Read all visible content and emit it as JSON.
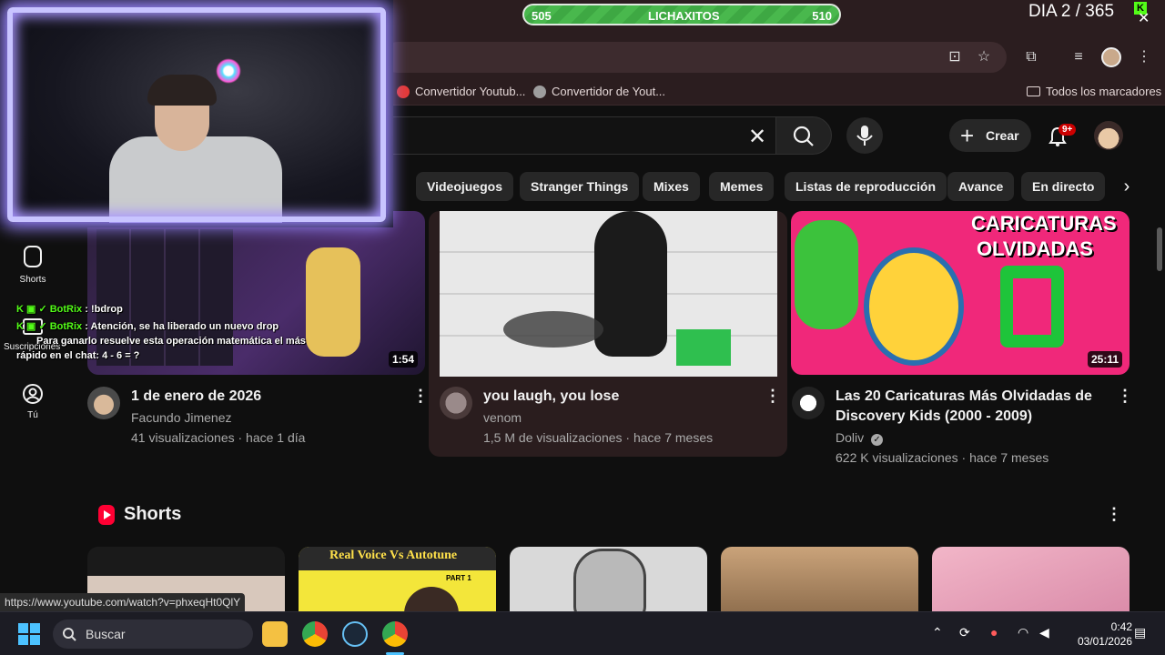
{
  "stream": {
    "progress_left": "505",
    "progress_label": "LICHAXITOS",
    "progress_right": "510",
    "day_counter": "DIA 2 / 365"
  },
  "bookmarks": {
    "items": [
      "Convertidor Youtub...",
      "Convertidor de Yout..."
    ],
    "all_label": "Todos los marcadores"
  },
  "youtube": {
    "create_label": "Crear",
    "notif_badge": "9+",
    "chips": [
      "Videojuegos",
      "Stranger Things",
      "Mixes",
      "Memes",
      "Listas de reproducción",
      "Avance",
      "En directo"
    ],
    "sidebar": {
      "shorts": "Shorts",
      "subs": "Suscripciones",
      "you": "Tú"
    },
    "videos": [
      {
        "title": "1 de enero de 2026",
        "channel": "Facundo Jimenez",
        "meta": "41 visualizaciones · hace 1 día",
        "duration": "1:54"
      },
      {
        "title": "you laugh, you lose",
        "channel": "venom",
        "meta": "1,5 M de visualizaciones · hace 7 meses",
        "duration": ""
      },
      {
        "title_line1": "Las 20 Caricaturas Más Olvidadas de",
        "title_line2": "Discovery Kids (2000 - 2009)",
        "channel": "Doliv",
        "meta": "622 K visualizaciones · hace 7 meses",
        "duration": "25:11",
        "thumb_line1": "CARICATURAS",
        "thumb_line2": "OLVIDADAS"
      }
    ],
    "shorts_title": "Shorts",
    "short_thumb_text": "Real Voice Vs Autotune",
    "short_thumb_part": "PART 1",
    "hover_url": "https://www.youtube.com/watch?v=phxeqHt0QlY"
  },
  "chat": [
    {
      "user": "BotRix",
      "text": ": !bdrop"
    },
    {
      "user": "BotRix",
      "text": ": Atención, se ha liberado un nuevo drop"
    },
    {
      "user": "",
      "text": "Para ganarlo resuelve esta operación matemática el más"
    },
    {
      "user": "",
      "text": "rápido en el chat: 4 - 6 = ?"
    }
  ],
  "taskbar": {
    "search_label": "Buscar",
    "time": "0:42",
    "date": "03/01/2026"
  },
  "colors": {
    "kick_green": "#53fc18",
    "yt_red": "#ff0033",
    "notif_red": "#cc0000"
  }
}
